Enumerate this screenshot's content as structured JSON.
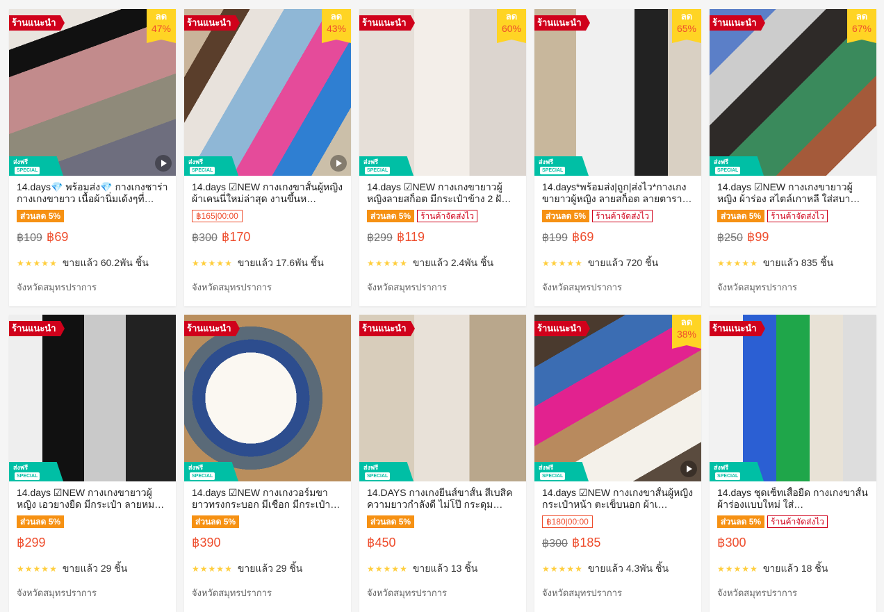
{
  "labels": {
    "mall": "ร้านแนะนำ",
    "discount_word": "ลด",
    "free_ship_top": "ส่งฟรี",
    "free_ship_special": "SPECIAL"
  },
  "colors": {
    "accent": "#ee4d2d",
    "mall_badge": "#d0011b",
    "discount_badge": "#ffd424",
    "free_ship": "#00bfa5",
    "discount_tag": "#f69113"
  },
  "products": [
    {
      "title": "14.days💎 พร้อมส่ง💎 กางเกงชาร่า กางเกงขายาว เนื้อผ้านิ่มเด้งๆที่…",
      "discount_pct": "47%",
      "tag_discount": "ส่วนลด 5%",
      "tag_flash": "",
      "tag_ship": "",
      "old_price": "฿109",
      "price": "฿69",
      "sold": "ขายแล้ว 60.2พัน ชิ้น",
      "rating": 5,
      "location": "จังหวัดสมุทรปราการ",
      "video": true
    },
    {
      "title": "14.days ☑NEW กางเกงขาสั้นผู้หญิง ผ้าเคนนี่ใหม่ล่าสุด งานขึ้นห…",
      "discount_pct": "43%",
      "tag_discount": "",
      "tag_flash": "฿165|00:00",
      "tag_ship": "",
      "old_price": "฿300",
      "price": "฿170",
      "sold": "ขายแล้ว 17.6พัน ชิ้น",
      "rating": 5,
      "location": "จังหวัดสมุทรปราการ",
      "video": true
    },
    {
      "title": "14.days ☑NEW กางเกงขายาวผู้หญิงลายสก็อต มีกระเป๋าข้าง 2 ฝั…",
      "discount_pct": "60%",
      "tag_discount": "ส่วนลด 5%",
      "tag_flash": "",
      "tag_ship": "ร้านค้าจัดส่งไว",
      "old_price": "฿299",
      "price": "฿119",
      "sold": "ขายแล้ว 2.4พัน ชิ้น",
      "rating": 5,
      "location": "จังหวัดสมุทรปราการ",
      "video": false
    },
    {
      "title": "14.days*พร้อมส่ง|ถูก|ส่งไว*กางเกงขายาวผู้หญิง ลายสก็อต ลายตารา…",
      "discount_pct": "65%",
      "tag_discount": "ส่วนลด 5%",
      "tag_flash": "",
      "tag_ship": "ร้านค้าจัดส่งไว",
      "old_price": "฿199",
      "price": "฿69",
      "sold": "ขายแล้ว 720 ชิ้น",
      "rating": 5,
      "location": "จังหวัดสมุทรปราการ",
      "video": false
    },
    {
      "title": "14.days ☑NEW กางเกงขายาวผู้หญิง ผ้าร่อง สไตล์เกาหลี ใส่สบา…",
      "discount_pct": "67%",
      "tag_discount": "ส่วนลด 5%",
      "tag_flash": "",
      "tag_ship": "ร้านค้าจัดส่งไว",
      "old_price": "฿250",
      "price": "฿99",
      "sold": "ขายแล้ว 835 ชิ้น",
      "rating": 5,
      "location": "จังหวัดสมุทรปราการ",
      "video": false
    },
    {
      "title": "14.days ☑NEW กางเกงขายาวผู้หญิง เอวยางยืด มีกระเป๋า ลายหม…",
      "discount_pct": "",
      "tag_discount": "ส่วนลด 5%",
      "tag_flash": "",
      "tag_ship": "",
      "old_price": "",
      "price": "฿299",
      "sold": "ขายแล้ว 29 ชิ้น",
      "rating": 4.5,
      "location": "จังหวัดสมุทรปราการ",
      "video": false
    },
    {
      "title": "14.days ☑NEW กางเกงวอร์มขายาวทรงกระบอก มีเชือก มีกระเป๋า ดี…",
      "discount_pct": "",
      "tag_discount": "ส่วนลด 5%",
      "tag_flash": "",
      "tag_ship": "",
      "old_price": "",
      "price": "฿390",
      "sold": "ขายแล้ว 29 ชิ้น",
      "rating": 5,
      "location": "จังหวัดสมุทรปราการ",
      "video": false
    },
    {
      "title": "14.DAYS กางเกงยีนส์ขาสั้น สีเบสิคความยาวกำลังดี ไม่โป๊ กระดุม…",
      "discount_pct": "",
      "tag_discount": "ส่วนลด 5%",
      "tag_flash": "",
      "tag_ship": "",
      "old_price": "",
      "price": "฿450",
      "sold": "ขายแล้ว 13 ชิ้น",
      "rating": 5,
      "location": "จังหวัดสมุทรปราการ",
      "video": false
    },
    {
      "title": "14.days ☑NEW กางเกงขาสั้นผู้หญิง กระเป๋าหน้า ตะเข็บนอก ผ้าเ…",
      "discount_pct": "38%",
      "tag_discount": "",
      "tag_flash": "฿180|00:00",
      "tag_ship": "",
      "old_price": "฿300",
      "price": "฿185",
      "sold": "ขายแล้ว 4.3พัน ชิ้น",
      "rating": 5,
      "location": "จังหวัดสมุทรปราการ",
      "video": true
    },
    {
      "title": "14.days ชุดเซ็ทเสื้อยืด กางเกงขาสั้น ผ้าร่องแบบใหม่ ใส่…",
      "discount_pct": "",
      "tag_discount": "ส่วนลด 5%",
      "tag_flash": "",
      "tag_ship": "ร้านค้าจัดส่งไว",
      "old_price": "",
      "price": "฿300",
      "sold": "ขายแล้ว 18 ชิ้น",
      "rating": 5,
      "location": "จังหวัดสมุทรปราการ",
      "video": false
    }
  ]
}
